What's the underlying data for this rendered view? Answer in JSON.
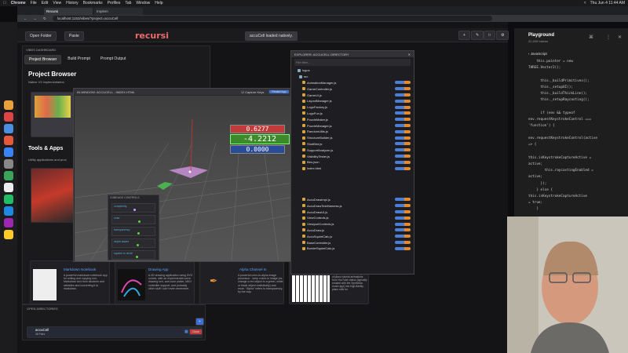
{
  "menubar": {
    "items": [
      "Chrome",
      "File",
      "Edit",
      "View",
      "History",
      "Bookmarks",
      "Profiles",
      "Tab",
      "Window",
      "Help"
    ],
    "clock": "Thu Jun 4  11:44 AM"
  },
  "browser": {
    "tabs": [
      "Recursi",
      "Implem"
    ],
    "url": "localhost:1153/vibes/?project=accuCell"
  },
  "app": {
    "open_folder": "Open Folder",
    "paste": "Paste",
    "logo": "recursi",
    "notice": "accuCell loaded natively."
  },
  "sidebar": {
    "heading": "VIBES DASHBOARD",
    "tabs": [
      "Project Browser",
      "Build Prompt",
      "Prompt Output"
    ],
    "title": "Project Browser",
    "subtitle": "Native V3 Implementation",
    "section": "Tools & Apps",
    "section_desc": "Utility applications and proc"
  },
  "cards": [
    {
      "title": "Markdown Notebook",
      "desc": "A powerful markdown notebook app for writing and copying non-Markdown text from students and websites and converting it to markdown."
    },
    {
      "title": "Drawing App",
      "desc": "A 2D drawing application using SVG curves, with an experimental curve drawing tool, and color picker, MIDI controller support, and probably other stuff I can't even remember."
    },
    {
      "title": "Alpha Channel In",
      "desc": "A powerful color-to-alpha image processor - keep colors in image (ex. change a red object to a green, white or black object realistically) and more. \"Alpha\" refers to transparency, by the way."
    },
    {
      "title": "",
      "desc": "simplified subset of MIDI) out of piano tutorial animations from YouTube videos (typically created with the Synthesia music app) into high-fidelity piano rolls for"
    }
  ],
  "open_dirs": {
    "heading": "OPEN DIRECTORIES",
    "item": "accuCell",
    "item_sub": "48 Files",
    "close": "Close"
  },
  "viewport_win": {
    "title": "IN-WINDOW: ACCUCELL - INDEX.HTML",
    "capture": "Capture Keys",
    "restart": "Restart App",
    "values": [
      "0.6277",
      "-4.2212",
      "0.0000"
    ],
    "controls_title": "CUBEAGE CONTROLS",
    "sliders": [
      {
        "label": "complexity",
        "pct": 0.5
      },
      {
        "label": "color",
        "pct": 0.62
      },
      {
        "label": "transparency",
        "pct": 0.6
      },
      {
        "label": "depth aware",
        "pct": 0.58
      },
      {
        "label": "square or circle",
        "pct": 0.55
      }
    ]
  },
  "explorer": {
    "title": "EXPLORER: ACCUCELL DIRECTORY",
    "file_filter": "File filter...",
    "root": "logos",
    "folder": "src",
    "files": [
      "AnimationManager.js",
      "GameController.js",
      "GameUI.js",
      "LayoutManager.js",
      "LogoFactory.js",
      "LogoFun.js",
      "PuzzleMaker.js",
      "PuzzleManager.js",
      "RandomUtils.js",
      "StructureBuilder.js",
      "StudBird.js",
      "SupportAnalyzer.js",
      "VisibilityTester.js",
      "files.json",
      "index.html"
    ],
    "files2": [
      "AccuDrawImpl.js",
      "AccuDrawTestHarness.js",
      "AccuDrawUI.js",
      "ViewControls.js",
      "ViewportControls.js",
      "AccuDraw.js",
      "AccuSquintCalc.js",
      "BaseController.js",
      "BorderSquintCalc.js"
    ]
  },
  "playground": {
    "title": "Playground",
    "tokens": "22,405 tokens",
    "lang": "JavaScript",
    "lines": [
      "    this.pointer = new",
      "THREE.Vector2();",
      "",
      "      this._buildPrimitives();",
      "      this._setupUI();",
      "      this._buildThickLine();",
      "      this._setupRaycasting();",
      "",
      "      if (env && typeof",
      "env.requestKeystrokeControl ===",
      "'function') {",
      "",
      "env.requestKeystrokeControl(active",
      "=> {",
      "",
      "this.isKeystrokeCaptureActive =",
      "active;",
      "        this.raycastingEnabled =",
      "active;",
      "      });",
      "    } else {",
      "this.isKeystrokeCaptureActive",
      "= true;",
      "    }",
      "",
      "      window.threeApp = this;"
    ]
  },
  "colors": {
    "accent": "#f06a6a",
    "blue": "#3b6fd6",
    "green": "#5ed33a",
    "red": "#c23b3b"
  }
}
